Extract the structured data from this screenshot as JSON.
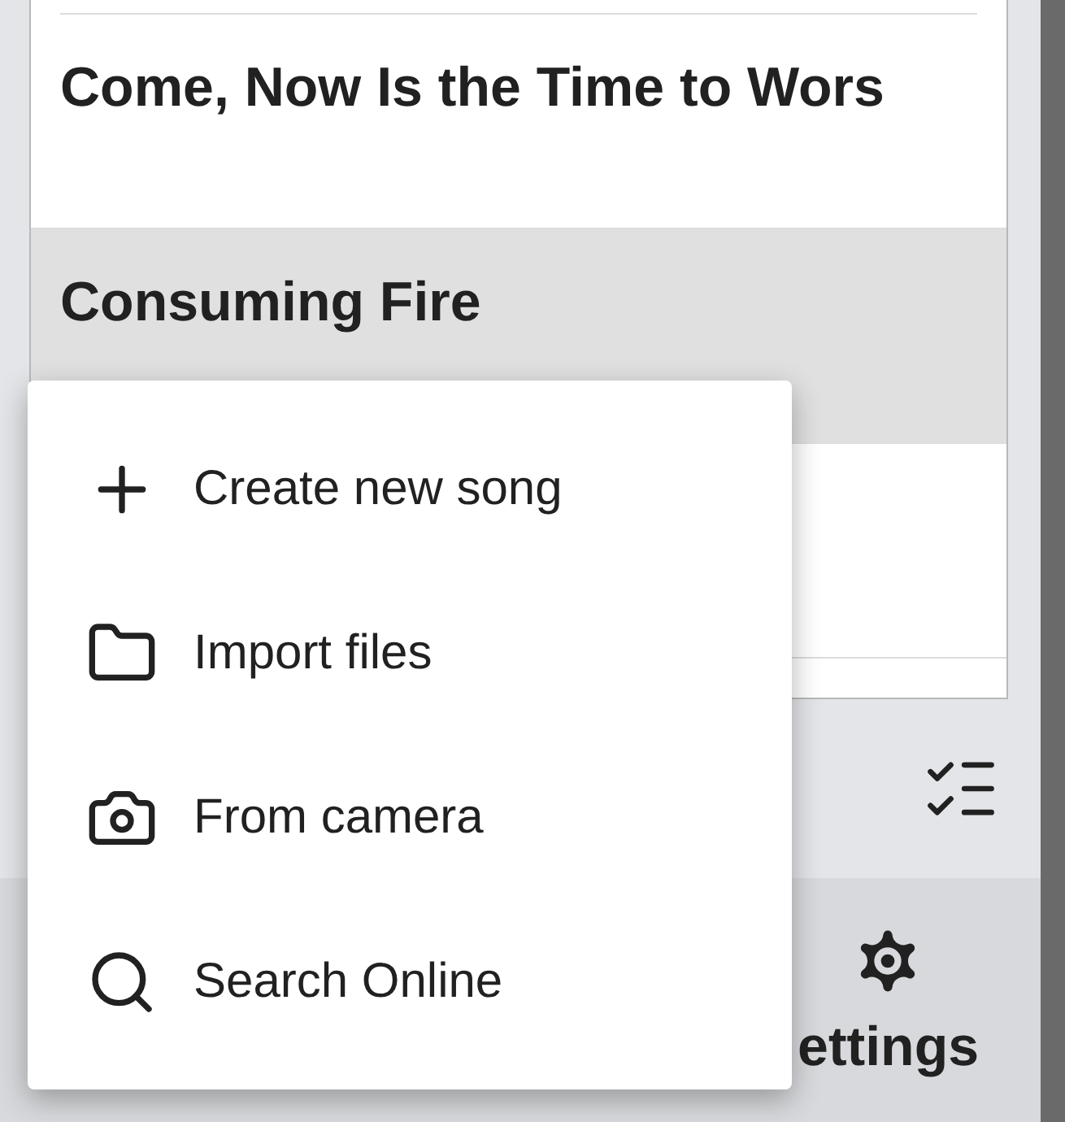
{
  "songs": [
    {
      "title": "Come, Now Is the Time to Wors",
      "selected": false
    },
    {
      "title": "Consuming Fire",
      "selected": true
    },
    {
      "selected": false
    }
  ],
  "menu": [
    {
      "kind": "add",
      "label": "Create new song"
    },
    {
      "kind": "folder",
      "label": "Import files"
    },
    {
      "kind": "camera",
      "label": "From camera"
    },
    {
      "kind": "search",
      "label": "Search Online"
    }
  ],
  "nav": [
    {
      "label": "ettings"
    }
  ]
}
